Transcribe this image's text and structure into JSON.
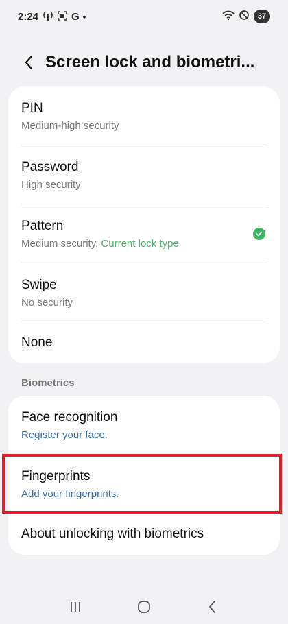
{
  "status_bar": {
    "time": "2:24",
    "left_icons": [
      "(o)",
      "[o]",
      "G",
      "•"
    ],
    "battery": "37"
  },
  "header": {
    "title": "Screen lock and biometri..."
  },
  "lock_types": [
    {
      "label": "PIN",
      "sub": "Medium-high security"
    },
    {
      "label": "Password",
      "sub": "High security"
    },
    {
      "label": "Pattern",
      "sub": "Medium security, ",
      "sub_highlight": "Current lock type"
    },
    {
      "label": "Swipe",
      "sub": "No security"
    },
    {
      "label": "None"
    }
  ],
  "biometrics": {
    "section_title": "Biometrics",
    "items": [
      {
        "label": "Face recognition",
        "sub": "Register your face."
      },
      {
        "label": "Fingerprints",
        "sub": "Add your fingerprints."
      },
      {
        "label": "About unlocking with biometrics"
      }
    ]
  },
  "colors": {
    "accent_blue": "#3a6fa6",
    "accent_green": "#4caf6e",
    "highlight_red": "#e0202a"
  },
  "nav_icons": [
    "recents-icon",
    "home-icon",
    "back-icon"
  ]
}
